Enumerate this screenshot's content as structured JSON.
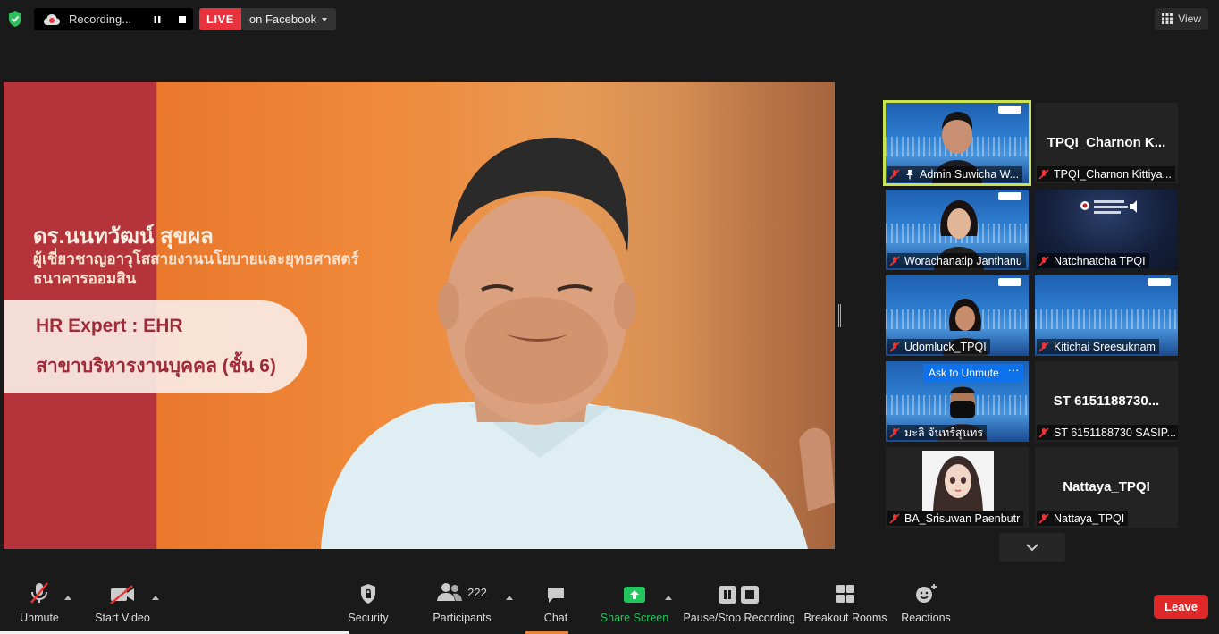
{
  "top_bar": {
    "recording_label": "Recording...",
    "live_label": "LIVE",
    "live_destination": "on Facebook",
    "view_label": "View"
  },
  "main_video": {
    "overlay_name": "ดร.นนทวัฒน์ สุขผล",
    "overlay_title_line1": "ผู้เชี่ยวชาญอาวุโสสายงานนโยบายและยุทธศาสตร์",
    "overlay_title_line2": "ธนาคารออมสิน",
    "card_line1": "HR Expert : EHR",
    "card_line2": "สาขาบริหารงานบุคคล (ชั้น 6)"
  },
  "gallery": {
    "tiles": [
      {
        "label": "Admin Suwicha W...",
        "active": true
      },
      {
        "label": "TPQI_Charnon Kittiya...",
        "center_name": "TPQI_Charnon  K..."
      },
      {
        "label": "Worachanatip Janthanu"
      },
      {
        "label": "Natchnatcha TPQI"
      },
      {
        "label": "Udomluck_TPQI"
      },
      {
        "label": "Kitichai Sreesuknam"
      },
      {
        "label": "มะลิ จันทร์สุนทร",
        "ask_unmute": "Ask to Unmute",
        "more": "···"
      },
      {
        "label": "ST 6151188730 SASIP...",
        "center_name": "ST 6151188730..."
      },
      {
        "label": "BA_Srisuwan Paenbutr"
      },
      {
        "label": "Nattaya_TPQI",
        "center_name": "Nattaya_TPQI"
      }
    ]
  },
  "toolbar": {
    "unmute": "Unmute",
    "start_video": "Start Video",
    "security": "Security",
    "participants": "Participants",
    "participants_count": "222",
    "chat": "Chat",
    "share_screen": "Share Screen",
    "pause_stop_recording": "Pause/Stop Recording",
    "breakout_rooms": "Breakout Rooms",
    "reactions": "Reactions",
    "leave": "Leave"
  },
  "colors": {
    "live_red": "#e8323e",
    "share_green": "#22c55e",
    "active_speaker": "#c8e34c",
    "leave_red": "#e02828",
    "ask_unmute_blue": "#0e72ed"
  }
}
